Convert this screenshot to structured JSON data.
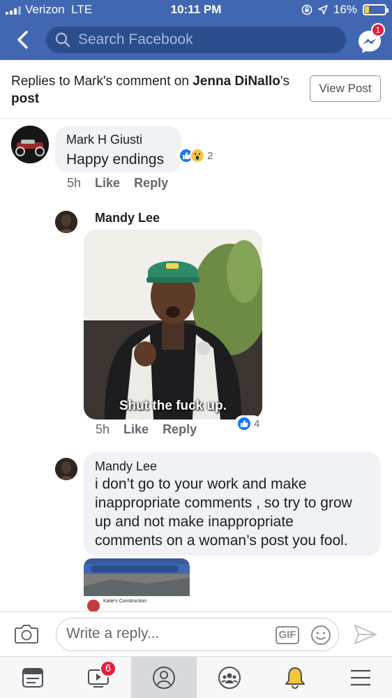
{
  "status_bar": {
    "carrier": "Verizon",
    "network": "LTE",
    "time": "10:11 PM",
    "battery": "16%"
  },
  "header": {
    "search_placeholder": "Search Facebook",
    "messenger_badge": "1",
    "brand_color": "#4267b2"
  },
  "context": {
    "prefix": "Replies to Mark's comment on ",
    "post_owner": "Jenna DiNallo",
    "suffix": "'s",
    "tail": "post",
    "view_post_label": "View Post"
  },
  "comments": [
    {
      "author": "Mark H Giusti",
      "text": "Happy endings",
      "time": "5h",
      "like_label": "Like",
      "reply_label": "Reply",
      "reaction_count": "2",
      "reactions": [
        "like",
        "wow"
      ]
    },
    {
      "author": "Mandy Lee",
      "gif_caption": "Shut the fuck up.",
      "time": "5h",
      "like_label": "Like",
      "reply_label": "Reply",
      "reaction_count": "4",
      "reactions": [
        "like"
      ]
    },
    {
      "author": "Mandy Lee",
      "text_lines": [
        "i don’t go to your work and make",
        "inappropriate comments , so try to grow",
        "up and not make inappropriate",
        "comments on a woman’s post you fool."
      ],
      "attachment": {
        "page_name": "Katie's Construction"
      }
    }
  ],
  "reply_bar": {
    "placeholder": "Write a reply...",
    "gif_label": "GIF"
  },
  "tabbar": {
    "video_badge": "6",
    "active_tab": "profile"
  }
}
